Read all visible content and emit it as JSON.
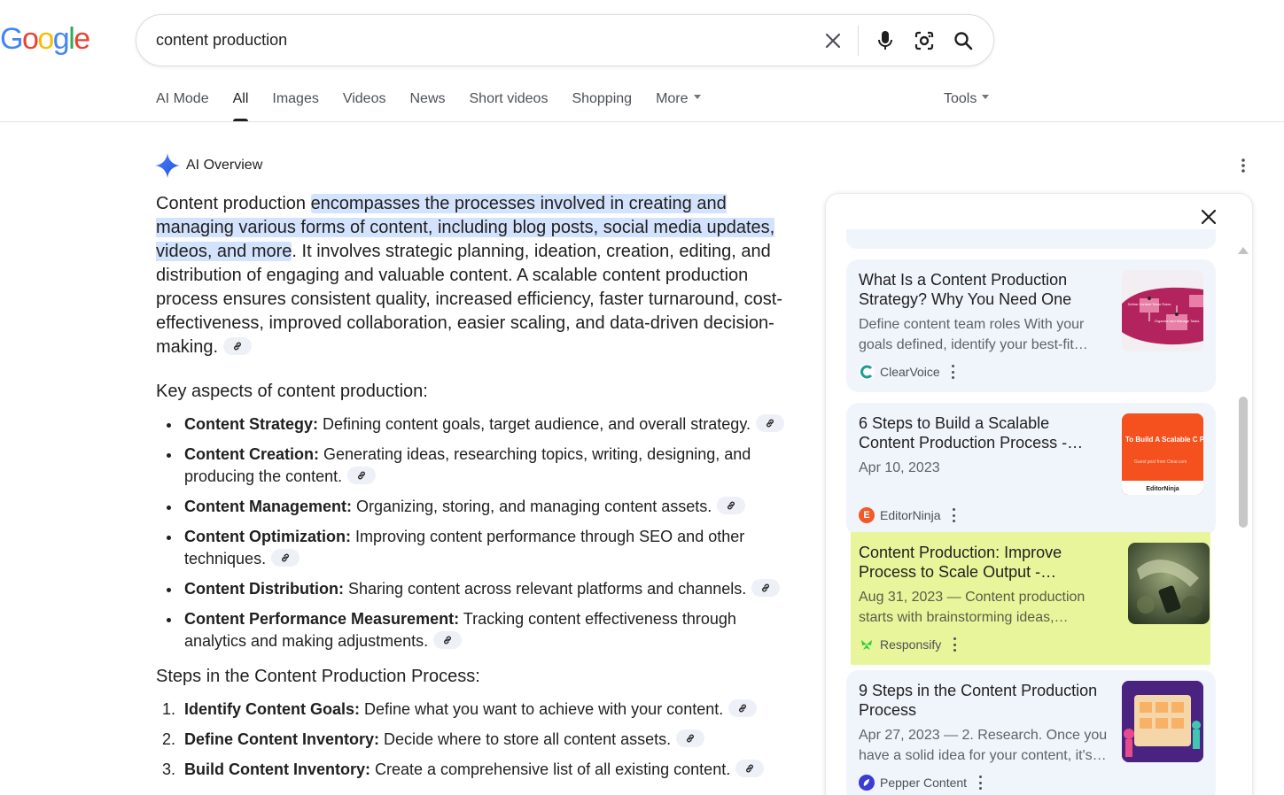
{
  "logo": {
    "letters": [
      "G",
      "o",
      "o",
      "g",
      "l",
      "e"
    ],
    "colors": [
      "#4285F4",
      "#EA4335",
      "#FBBC05",
      "#4285F4",
      "#34A853",
      "#EA4335"
    ]
  },
  "search": {
    "query": "content production"
  },
  "tabs": [
    {
      "label": "AI Mode"
    },
    {
      "label": "All"
    },
    {
      "label": "Images"
    },
    {
      "label": "Videos"
    },
    {
      "label": "News"
    },
    {
      "label": "Short videos"
    },
    {
      "label": "Shopping"
    },
    {
      "label": "More"
    }
  ],
  "tools_label": "Tools",
  "ai_overview": {
    "title": "AI Overview",
    "intro": {
      "lead": "Content production ",
      "highlight": "encompasses the processes involved in creating and managing various forms of content, including blog posts, social media updates, videos, and more",
      "rest": ". It involves strategic planning, ideation, creation, editing, and distribution of engaging and valuable content. A scalable content production process ensures consistent quality, increased efficiency, faster turnaround, cost-effectiveness, improved collaboration, easier scaling, and data-driven decision-making."
    },
    "aspects_heading": "Key aspects of content production:",
    "aspects": [
      {
        "term": "Content Strategy:",
        "text": " Defining content goals, target audience, and overall strategy."
      },
      {
        "term": "Content Creation:",
        "text": " Generating ideas, researching topics, writing, designing, and producing the content."
      },
      {
        "term": "Content Management:",
        "text": " Organizing, storing, and managing content assets."
      },
      {
        "term": "Content Optimization:",
        "text": " Improving content performance through SEO and other techniques."
      },
      {
        "term": "Content Distribution:",
        "text": " Sharing content across relevant platforms and channels."
      },
      {
        "term": "Content Performance Measurement:",
        "text": " Tracking content effectiveness through analytics and making adjustments."
      }
    ],
    "steps_heading": "Steps in the Content Production Process:",
    "steps": [
      {
        "num": "1.",
        "term": "Identify Content Goals:",
        "text": " Define what you want to achieve with your content."
      },
      {
        "num": "2.",
        "term": "Define Content Inventory:",
        "text": " Decide where to store all content assets."
      },
      {
        "num": "3.",
        "term": "Build Content Inventory:",
        "text": " Create a comprehensive list of all existing content."
      }
    ]
  },
  "sources": [
    {
      "title": "What Is a Content Production Strategy? Why You Need One",
      "snippet": "Define content team roles With your goals defined, identify your best-fit…",
      "site": "ClearVoice",
      "favicon_color": "#1aa08f"
    },
    {
      "title": "6 Steps to Build a Scalable Content Production Process - EditorNinja",
      "snippet": "Apr 10, 2023",
      "site": "EditorNinja",
      "favicon_color": "#f05a28",
      "thumb_text": "To Build A Scalable C Production Process",
      "thumb_sub": "Guest post from Clear.com",
      "thumb_brand": "EditorNinja"
    },
    {
      "title": "Content Production: Improve Process to Scale Output -…",
      "snippet": "Aug 31, 2023 — Content production starts with brainstorming ideas, writing…",
      "site": "Responsify",
      "favicon_color": "#2ecc40"
    },
    {
      "title": "9 Steps in the Content Production Process",
      "snippet": "Apr 27, 2023 — 2. Research. Once you have a solid idea for your content, it's…",
      "site": "Pepper Content",
      "favicon_color": "#3b3bd6"
    }
  ],
  "thumb1_labels": [
    "Define Content Team Roles",
    "Organize and Manage Tasks"
  ]
}
